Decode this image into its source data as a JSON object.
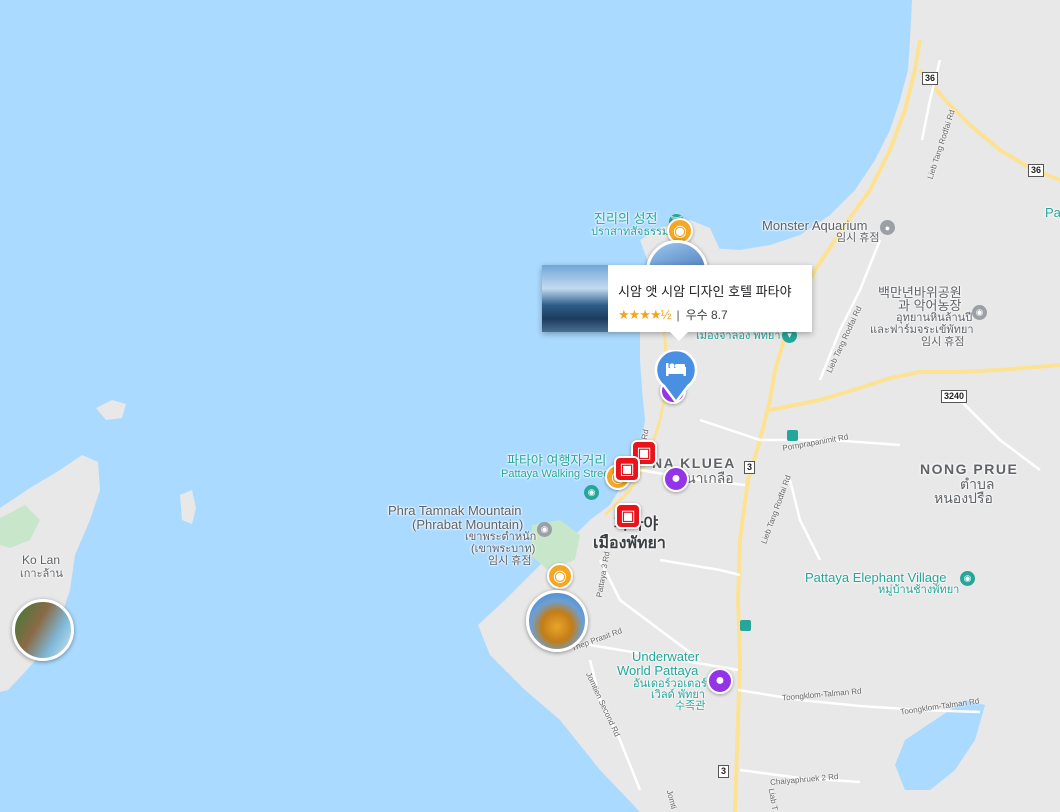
{
  "colors": {
    "water": "#aadaff",
    "land": "#e8e8e8",
    "park": "#c8e6c9",
    "major_road": "#fde293",
    "road": "#ffffff",
    "hotel_pin": "#4a90e2",
    "shopping_pin": "#e8141c",
    "purple_pin": "#9334e6",
    "attraction_pin": "#f5a623",
    "poi_teal": "#26a69a",
    "poi_gray": "#9aa0a6"
  },
  "hotel_card": {
    "title": "시암 앳 시암 디자인 호텔 파타야",
    "stars": "★★★★½",
    "rating_text": "우수 8.7",
    "separator": "|"
  },
  "labels": {
    "sanctuary_kr": "진리의 성전",
    "sanctuary_th": "ปราสาทสัจธรรม",
    "monster_aquarium": "Monster Aquarium",
    "monster_aquarium_sub": "임시 휴점",
    "park_kr": "백만년바위공원",
    "park_kr2": "과 악어농장",
    "park_th1": "อุทยานหินล้านปี",
    "park_th2": "และฟาร์มจระเข้พัทยา",
    "park_sub": "임시 휴점",
    "mueang_th": "เมืองจำลอง พัทยา",
    "walking_kr": "파타야 여행자거리",
    "walking_en": "Pattaya Walking Street",
    "na_kluea": "NA KLUEA",
    "na_kluea_th": "นาเกลือ",
    "pattaya_kr": "파타야",
    "pattaya_th": "เมืองพัทยา",
    "phra_tamnak": "Phra Tamnak Mountain",
    "phrabat": "(Phrabat Mountain)",
    "phra_tamnak_th1": "เขาพระตำหนัก",
    "phra_tamnak_th2": "(เขาพระบาท)",
    "phra_tamnak_sub": "임시 휴점",
    "ko_lan": "Ko Lan",
    "ko_lan_th": "เกาะล้าน",
    "nong_prue": "NONG PRUE",
    "nong_prue_th1": "ตำบล",
    "nong_prue_th2": "หนองปรือ",
    "elephant_village": "Pattaya Elephant Village",
    "elephant_village_th": "หมู่บ้านช้างพัทยา",
    "underwater1": "Underwater",
    "underwater2": "World Pattaya",
    "underwater_th1": "อันเดอร์วอเตอร์",
    "underwater_th2": "เวิลด์ พัทยา",
    "underwater_sub": "수족관",
    "pa_edge": "Pa"
  },
  "roads": {
    "liab_tang_rodfai_1": "Lieb Tang Rodfai Rd",
    "liab_tang_rodfai_2": "Lieb Tang Rodfai Rd",
    "liab_tang_rodfai_3": "Lieb Tang Rodfai Rd",
    "pornprapanimit": "Pornprapanimit Rd",
    "thep_prasit": "Thep Prasit Rd",
    "jomtien_second": "Jomtien Second Rd",
    "toongklom_1": "Toongklom-Talman Rd",
    "toongklom_2": "Toongklom-Talman Rd",
    "chaiyaphruek": "Chaiyaphruek 2 Rd",
    "rd_a": "Rd",
    "rd_b": "Pattaya 3 Rd",
    "rd_c": "Jomti",
    "rd_d": "Liab T"
  },
  "shields": {
    "s36a": "36",
    "s36b": "36",
    "s3240": "3240",
    "s3a": "3",
    "s3b": "3"
  }
}
